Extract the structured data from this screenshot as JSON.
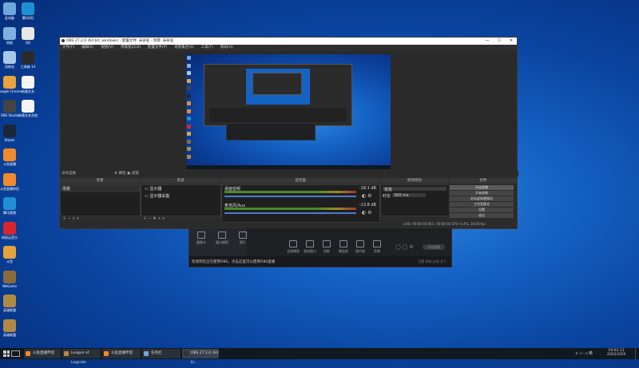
{
  "desktop": {
    "icons_left": [
      {
        "label": "此电脑",
        "color": "#6fa8dc"
      },
      {
        "label": "网络",
        "color": "#7fb0e0"
      },
      {
        "label": "回收站",
        "color": "#aac8e8"
      },
      {
        "label": "Google Chrome",
        "color": "#e8a33c"
      },
      {
        "label": "OBS Studio",
        "color": "#444"
      },
      {
        "label": "Steam",
        "color": "#1b2838"
      },
      {
        "label": "斗鱼直播",
        "color": "#f08a2c"
      },
      {
        "label": "斗鱼直播伴侣",
        "color": "#f08a2c"
      },
      {
        "label": "腾讯视频",
        "color": "#1e8fd6"
      },
      {
        "label": "网易云音乐",
        "color": "#d8262e"
      },
      {
        "label": "斗鱼",
        "color": "#e6a23c"
      },
      {
        "label": "WeGame",
        "color": "#8a6c3a"
      },
      {
        "label": "英雄联盟",
        "color": "#b08a45"
      },
      {
        "label": "英雄联盟",
        "color": "#b08a45"
      }
    ],
    "icons_right": [
      {
        "label": "腾讯QQ",
        "color": "#1e8fd6"
      },
      {
        "label": "QQ",
        "color": "#e8e8e8"
      },
      {
        "label": "工具箱 14",
        "color": "#2a2a2a"
      },
      {
        "label": "新建文本",
        "color": "#f5f5f5"
      },
      {
        "label": "新建文本文档",
        "color": "#f5f5f5"
      }
    ]
  },
  "obs": {
    "title": "OBS 27.2.0 (64 bit, windows) - 配置文件: 未命名 - 场景: 未命名",
    "menu": [
      "文件(F)",
      "编辑(E)",
      "视图(V)",
      "停靠窗口(D)",
      "配置文件(P)",
      "场景集合(S)",
      "工具(T)",
      "帮助(H)"
    ],
    "preview_bar": {
      "left": "没有选择",
      "mid": "⚙ 属性   ▣ 滤镜"
    },
    "docks": {
      "scenes": {
        "title": "场景",
        "item": "场景"
      },
      "sources": {
        "title": "来源",
        "items": [
          "显示器",
          "显示器采集"
        ]
      },
      "mixer": {
        "title": "混音器",
        "channels": [
          {
            "name": "桌面音频",
            "db": "-18.1 dB"
          },
          {
            "name": "麦克风/Aux",
            "db": "-13.8 dB"
          }
        ]
      },
      "transitions": {
        "title": "转场特效",
        "type": "渐变",
        "duration_label": "时长",
        "duration": "300 ms"
      },
      "controls": {
        "title": "控件",
        "buttons": [
          "开始直播",
          "开始录制",
          "启动虚拟摄像机",
          "工作室模式",
          "设置",
          "退出"
        ]
      }
    },
    "status": "LIVE: 00:00:00   REC: 00:00:00   CPU: 0.4%, 30.00 fps"
  },
  "streamer": {
    "top_icons": [
      "摄像头",
      "窗口捕获",
      "图片"
    ],
    "bottom_icons": [
      "全屏捕获",
      "游戏窗口",
      "投影",
      "横竖屏",
      "画中画",
      "音频"
    ],
    "start_label": "开始直播",
    "notice": "检测到您正在使用OBS，点击这里可以使用OBS直播",
    "right_links": [
      "设置",
      "帮助",
      "反馈",
      "关于"
    ]
  },
  "taskbar": {
    "items": [
      {
        "label": "斗鱼直播伴侣",
        "color": "#f08a2c"
      },
      {
        "label": "League of Legends",
        "color": "#b08a45"
      },
      {
        "label": "斗鱼直播伴侣",
        "color": "#f08a2c"
      },
      {
        "label": "任务栏",
        "color": "#6fa8dc"
      },
      {
        "label": "OBS 27.2.0 (64 bi...",
        "color": "#333"
      }
    ],
    "time": "19:01:13",
    "date": "2022/3/19"
  }
}
